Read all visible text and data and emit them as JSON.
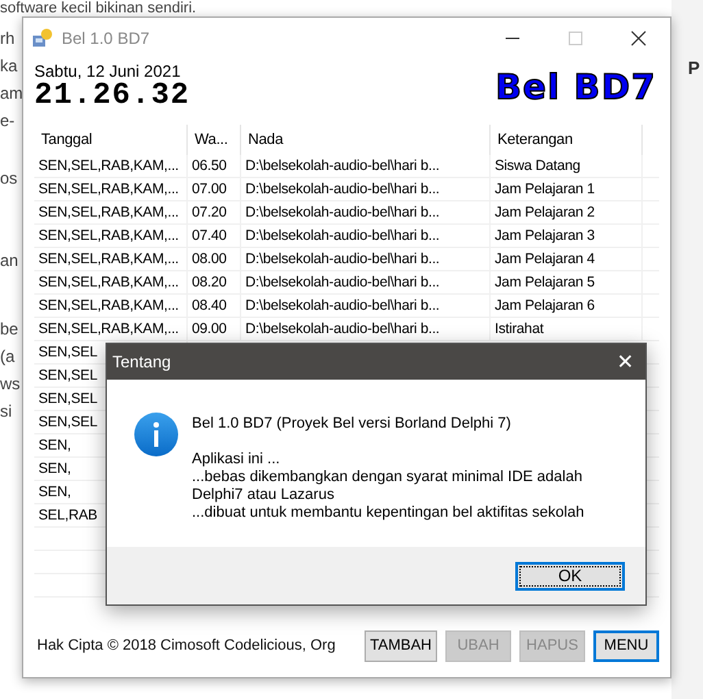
{
  "background_page": {
    "heading_fragment": "software kecil bikinan sendiri.",
    "left_fragments": [
      "rh",
      "ka",
      "am",
      "e-",
      "os",
      "an",
      "be",
      "(a",
      "ws",
      "si"
    ],
    "right_fragment": "P"
  },
  "window": {
    "title": "Bel 1.0 BD7",
    "date": "Sabtu, 12 Juni 2021",
    "clock": "21.26.32",
    "logo": "Bel BD7"
  },
  "table": {
    "columns": [
      "Tanggal",
      "Wa...",
      "Nada",
      "Keterangan"
    ],
    "rows": [
      {
        "cells": [
          "SEN,SEL,RAB,KAM,...",
          "06.50",
          "D:\\belsekolah-audio-bel\\hari b...",
          "Siswa Datang"
        ]
      },
      {
        "cells": [
          "SEN,SEL,RAB,KAM,...",
          "07.00",
          "D:\\belsekolah-audio-bel\\hari b...",
          "Jam Pelajaran 1"
        ]
      },
      {
        "cells": [
          "SEN,SEL,RAB,KAM,...",
          "07.20",
          "D:\\belsekolah-audio-bel\\hari b...",
          "Jam Pelajaran 2"
        ]
      },
      {
        "cells": [
          "SEN,SEL,RAB,KAM,...",
          "07.40",
          "D:\\belsekolah-audio-bel\\hari b...",
          "Jam Pelajaran 3"
        ]
      },
      {
        "cells": [
          "SEN,SEL,RAB,KAM,...",
          "08.00",
          "D:\\belsekolah-audio-bel\\hari b...",
          "Jam Pelajaran 4"
        ]
      },
      {
        "cells": [
          "SEN,SEL,RAB,KAM,...",
          "08.20",
          "D:\\belsekolah-audio-bel\\hari b...",
          "Jam Pelajaran 5"
        ]
      },
      {
        "cells": [
          "SEN,SEL,RAB,KAM,...",
          "08.40",
          "D:\\belsekolah-audio-bel\\hari b...",
          "Jam Pelajaran 6"
        ]
      },
      {
        "cells": [
          "SEN,SEL,RAB,KAM,...",
          "09.00",
          "D:\\belsekolah-audio-bel\\hari b...",
          "Istirahat"
        ]
      },
      {
        "cells": [
          "SEN,SEL"
        ]
      },
      {
        "cells": [
          "SEN,SEL"
        ]
      },
      {
        "cells": [
          "SEN,SEL"
        ]
      },
      {
        "cells": [
          "SEN,SEL"
        ]
      },
      {
        "cells": [
          "SEN,"
        ]
      },
      {
        "cells": [
          "SEN,"
        ]
      },
      {
        "cells": [
          "SEN,"
        ]
      },
      {
        "cells": [
          "SEL,RAB"
        ]
      }
    ]
  },
  "footer": {
    "copyright": "Hak Cipta © 2018 Cimosoft Codelicious, Org",
    "buttons": [
      {
        "label": "TAMBAH",
        "disabled": false,
        "focused": false
      },
      {
        "label": "UBAH",
        "disabled": true,
        "focused": false
      },
      {
        "label": "HAPUS",
        "disabled": true,
        "focused": false
      },
      {
        "label": "MENU",
        "disabled": false,
        "focused": true
      }
    ]
  },
  "dialog": {
    "title": "Tentang",
    "close": "✕",
    "heading": "Bel 1.0 BD7 (Proyek Bel versi Borland Delphi 7)",
    "lines": [
      "Aplikasi ini ...",
      "...bebas dikembangkan dengan syarat minimal IDE adalah",
      "Delphi7 atau Lazarus",
      "...dibuat untuk membantu kepentingan bel aktifitas sekolah"
    ],
    "button": {
      "label": "OK",
      "focused": true
    }
  }
}
